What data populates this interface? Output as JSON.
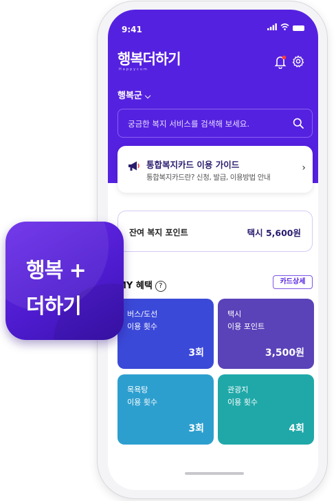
{
  "status": {
    "time": "9:41"
  },
  "header": {
    "logo": "행복더하기",
    "logo_sub": "Happycum",
    "region": "행복군",
    "search_placeholder": "궁금한 복지 서비스를 검색해 보세요."
  },
  "guide": {
    "title": "통합복지카드 이용 가이드",
    "subtitle": "통합복지카드란? 신청, 발급, 이용방법 안내"
  },
  "points": {
    "label": "잔여 복지 포인트",
    "value": "택시 5,600원"
  },
  "benefits": {
    "title": "MY 혜택",
    "card_detail": "카드상세",
    "tiles": [
      {
        "line1": "버스/도선",
        "line2": "이용 횟수",
        "value": "3회",
        "color": "#3b49d8"
      },
      {
        "line1": "택시",
        "line2": "이용 포인트",
        "value": "3,500원",
        "color": "#5a42b8"
      },
      {
        "line1": "목욕탕",
        "line2": "이용 횟수",
        "value": "3회",
        "color": "#2d9fcf"
      },
      {
        "line1": "관광지",
        "line2": "이용 횟수",
        "value": "4회",
        "color": "#20a8a8"
      }
    ]
  },
  "app_icon": {
    "line1": "행복 +",
    "line2": "더하기"
  },
  "colors": {
    "brand": "#5521e0",
    "accent_red": "#ff3b3b"
  }
}
